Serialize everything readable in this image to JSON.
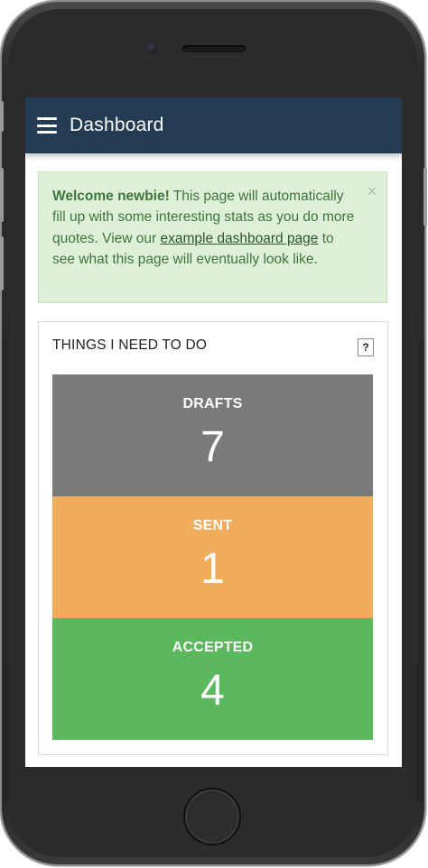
{
  "header": {
    "title": "Dashboard",
    "menu_icon": "hamburger-menu-icon"
  },
  "alert": {
    "bold": "Welcome newbie!",
    "text_before_link": " This page will automatically fill up with some interesting stats as you do more quotes. View our ",
    "link_text": "example dashboard page",
    "text_after_link": " to see what this page will eventually look like.",
    "close": "×"
  },
  "todo": {
    "title": "THINGS I NEED TO DO",
    "help_label": "?",
    "tiles": [
      {
        "label": "DRAFTS",
        "count": "7",
        "color": "#7a7a7a"
      },
      {
        "label": "SENT",
        "count": "1",
        "color": "#f0ad5e"
      },
      {
        "label": "ACCEPTED",
        "count": "4",
        "color": "#5cb85c"
      }
    ]
  },
  "colors": {
    "navbar": "#243b54",
    "alert_bg": "#dff0d8",
    "alert_text": "#3c763d"
  }
}
